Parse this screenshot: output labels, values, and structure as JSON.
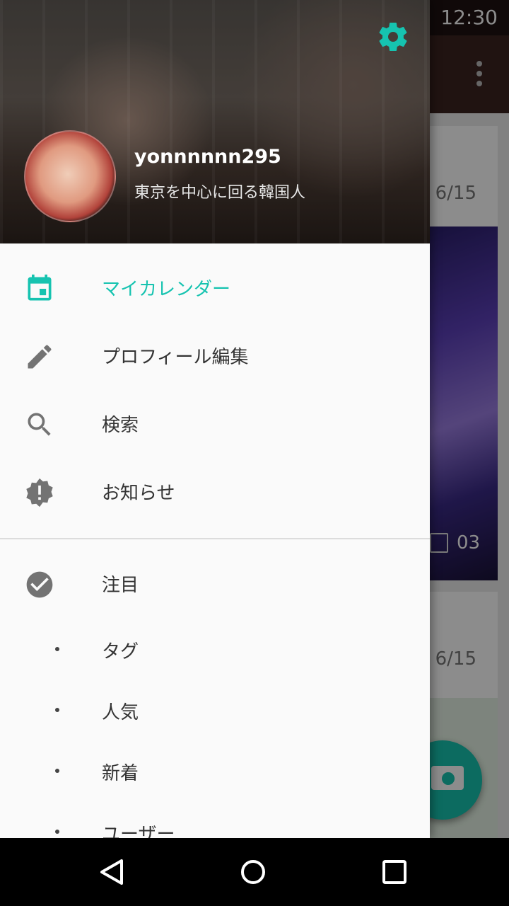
{
  "status_bar": {
    "time": "12:30"
  },
  "background": {
    "card1_date": "6/15",
    "card2_date": "6/15",
    "comment_count": "03"
  },
  "drawer": {
    "username": "yonnnnnn295",
    "bio": "東京を中心に回る韓国人",
    "menu": [
      {
        "label": "マイカレンダー",
        "icon": "calendar-icon",
        "active": true
      },
      {
        "label": "プロフィール編集",
        "icon": "pencil-icon"
      },
      {
        "label": "検索",
        "icon": "search-icon"
      },
      {
        "label": "お知らせ",
        "icon": "alert-badge-icon"
      },
      {
        "label": "注目",
        "icon": "check-circle-icon"
      }
    ],
    "sub_items": [
      "タグ",
      "人気",
      "新着",
      "ユーザー"
    ]
  },
  "colors": {
    "accent": "#16c3b0",
    "icon_gray": "#737373"
  }
}
